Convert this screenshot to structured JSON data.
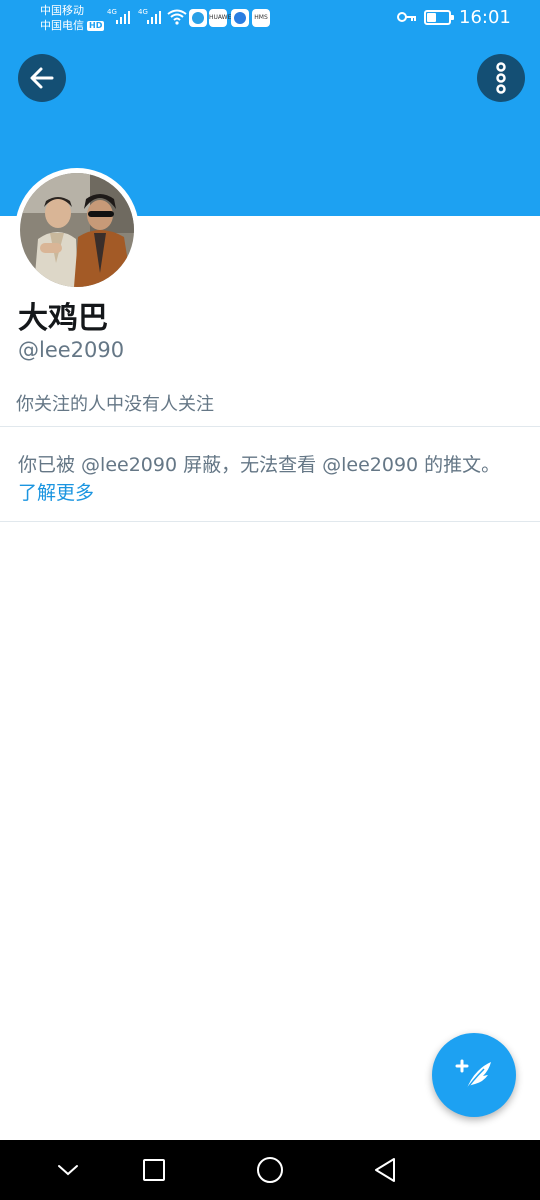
{
  "status_bar": {
    "carrier1": "中国移动",
    "carrier2": "中国电信",
    "hd_badge": "HD",
    "network_type_1": "4G",
    "network_type_2": "4G",
    "app_icon_huawei": "HUAWEI",
    "app_icon_hms": "HMS",
    "time": "16:01",
    "battery_level": 0.45
  },
  "header": {
    "back_icon": "arrow-left-icon",
    "more_icon": "more-vertical-icon",
    "banner_color": "#1da1f2"
  },
  "profile": {
    "display_name": "大鸡巴",
    "handle": "@lee2090",
    "followed_by_text": "你关注的人中没有人关注"
  },
  "blocked": {
    "message": "你已被 @lee2090 屏蔽，无法查看 @lee2090 的推文。",
    "learn_more": "了解更多"
  },
  "fab": {
    "icon": "compose-tweet-icon"
  },
  "nav_bar": {
    "icons": [
      "chevron-down-icon",
      "square-recent-icon",
      "circle-home-icon",
      "triangle-back-icon"
    ]
  },
  "colors": {
    "accent": "#1da1f2",
    "link": "#1b95e0",
    "secondary_text": "#657786",
    "dark_button": "#144f74"
  }
}
